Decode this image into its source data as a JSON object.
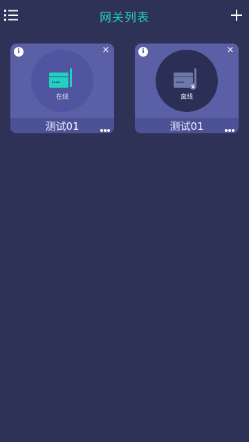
{
  "header": {
    "title": "网关列表",
    "menu_icon": "list-menu-icon",
    "add_icon": "plus-icon"
  },
  "colors": {
    "background": "#2e3256",
    "title": "#23d0c2",
    "card": "#5a5fa6",
    "router_online": "#23d0c2",
    "router_offline": "#6f78a8"
  },
  "gateways": [
    {
      "name": "测试01",
      "status": "在线",
      "status_key": "online",
      "icon": "router-icon"
    },
    {
      "name": "测试01",
      "status": "离线",
      "status_key": "offline",
      "icon": "router-offline-icon"
    }
  ],
  "card_controls": {
    "info_label": "i",
    "close_label": "×"
  }
}
